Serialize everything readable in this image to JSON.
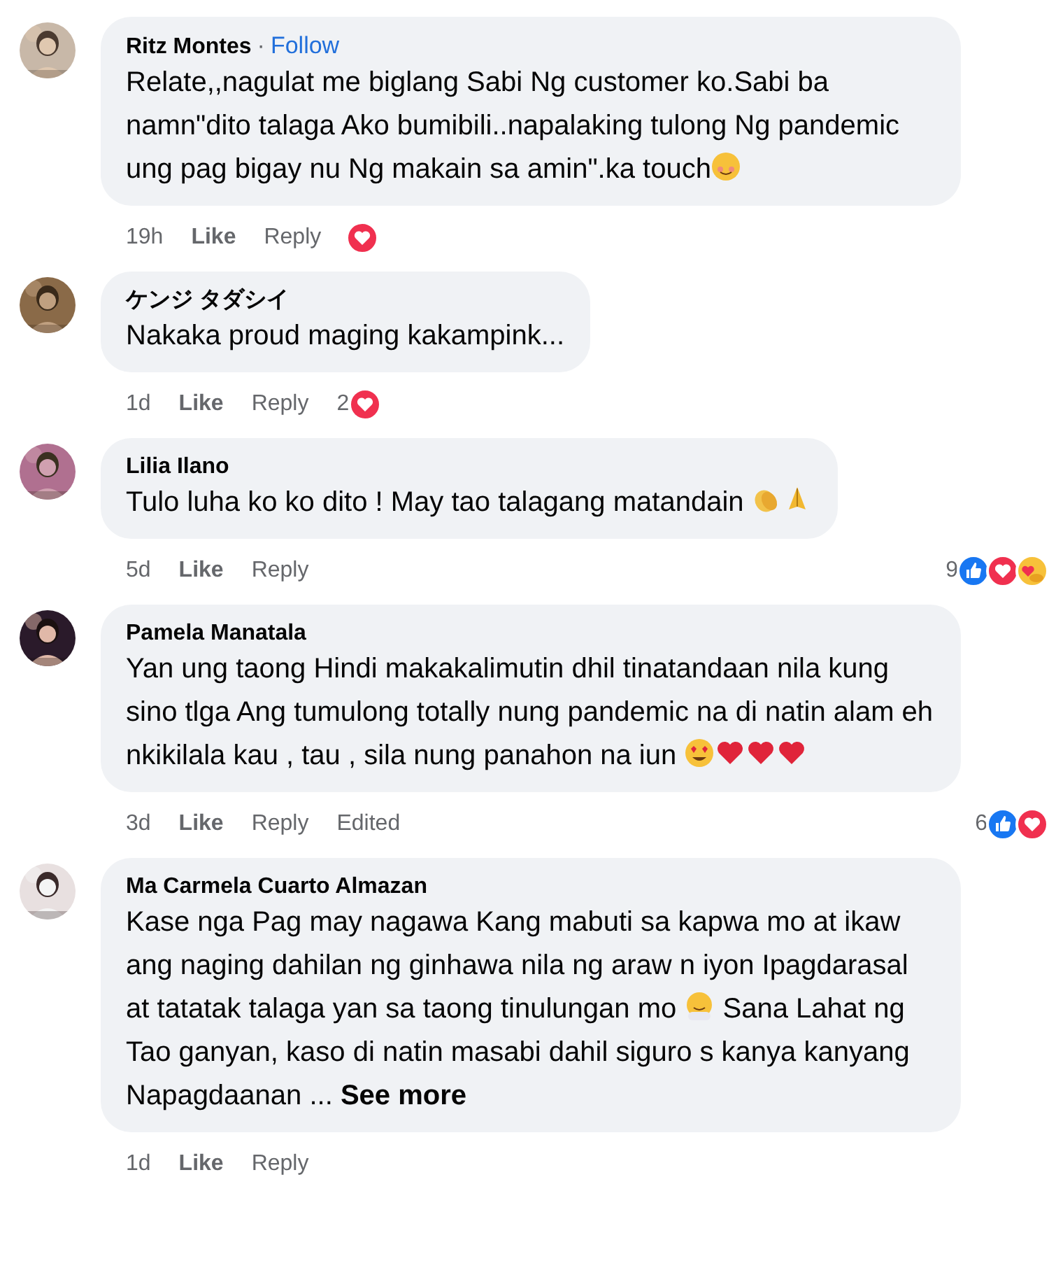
{
  "comments": [
    {
      "author": "Ritz Montes",
      "separator": "·",
      "follow": "Follow",
      "avatar": {
        "kind": "picture"
      },
      "body": [
        {
          "kind": "text",
          "text": "Relate,,nagulat me biglang Sabi Ng customer ko.Sabi ba namn\"dito talaga Ako bumibili..napalaking tulong Ng pandemic ung pag bigay nu Ng makain sa amin\".ka touch"
        },
        {
          "kind": "blush"
        }
      ],
      "time": "19h",
      "like": "Like",
      "reply": "Reply",
      "reactions": [
        {
          "kind": "love"
        }
      ]
    },
    {
      "author": "ケンジ タダシイ",
      "avatar": {
        "kind": "picture"
      },
      "body": [
        {
          "kind": "text",
          "text": "Nakaka proud maging kakampink..."
        }
      ],
      "time": "1d",
      "like": "Like",
      "reply": "Reply",
      "reaction_count": "2",
      "reactions": [
        {
          "kind": "love"
        }
      ]
    },
    {
      "author": "Lilia Ilano",
      "avatar": {
        "kind": "picture"
      },
      "body": [
        {
          "kind": "text",
          "text": "Tulo luha ko ko dito ! May tao talagang matandain "
        },
        {
          "kind": "clap"
        },
        {
          "kind": "pray"
        }
      ],
      "time": "5d",
      "like": "Like",
      "reply": "Reply",
      "reaction_count": "9",
      "reactions": [
        {
          "kind": "like"
        },
        {
          "kind": "love"
        },
        {
          "kind": "care"
        }
      ]
    },
    {
      "author": "Pamela Manatala",
      "avatar": {
        "kind": "picture"
      },
      "body": [
        {
          "kind": "text",
          "text": "Yan ung taong Hindi makakalimutin dhil tinatandaan nila kung sino tlga Ang tumulong totally nung pandemic na di natin alam eh nkikilala kau , tau , sila nung panahon na iun "
        },
        {
          "kind": "heart-eyes"
        },
        {
          "kind": "heart"
        },
        {
          "kind": "heart"
        },
        {
          "kind": "heart"
        }
      ],
      "time": "3d",
      "like": "Like",
      "reply": "Reply",
      "edited": "Edited",
      "reaction_count": "6",
      "reactions": [
        {
          "kind": "like"
        },
        {
          "kind": "love"
        }
      ]
    },
    {
      "author": "Ma Carmela Cuarto Almazan",
      "avatar": {
        "kind": "picture"
      },
      "body": [
        {
          "kind": "text",
          "text": "Kase nga Pag may nagawa Kang mabuti sa kapwa mo at ikaw ang naging dahilan ng ginhawa nila ng araw n iyon Ipagdarasal at tatatak talaga yan sa taong tinulungan mo "
        },
        {
          "kind": "hug"
        },
        {
          "kind": "text",
          "text": " Sana Lahat ng Tao ganyan, kaso di natin masabi dahil siguro s kanya kanyang Napagdaanan ..."
        }
      ],
      "see_more": "See more",
      "time": "1d",
      "like": "Like",
      "reply": "Reply"
    }
  ]
}
